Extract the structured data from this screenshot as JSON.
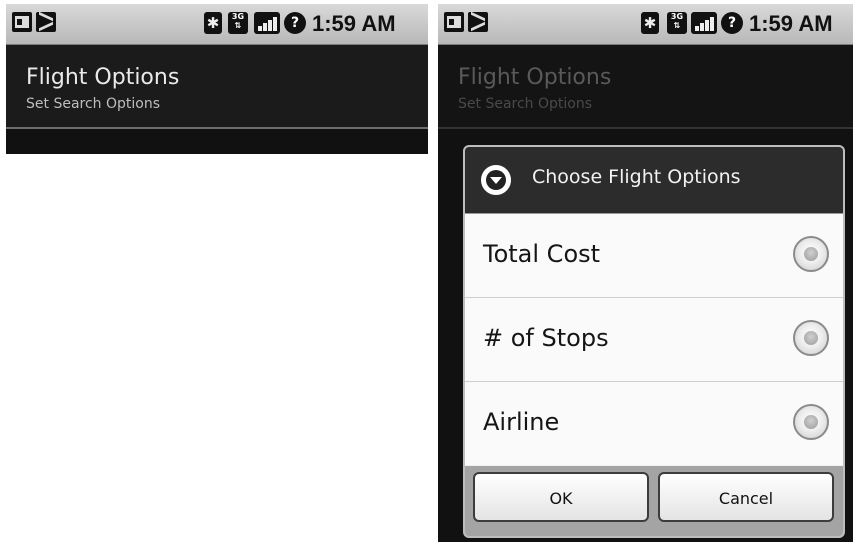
{
  "status_bar": {
    "time": "1:59 AM"
  },
  "header": {
    "title": "Flight Options",
    "subtitle": "Set Search Options"
  },
  "dialog": {
    "title": "Choose Flight Options",
    "options": [
      {
        "label": "Total Cost",
        "selected": false
      },
      {
        "label": "# of Stops",
        "selected": false
      },
      {
        "label": "Airline",
        "selected": false
      }
    ],
    "buttons": {
      "ok": "OK",
      "cancel": "Cancel"
    }
  }
}
